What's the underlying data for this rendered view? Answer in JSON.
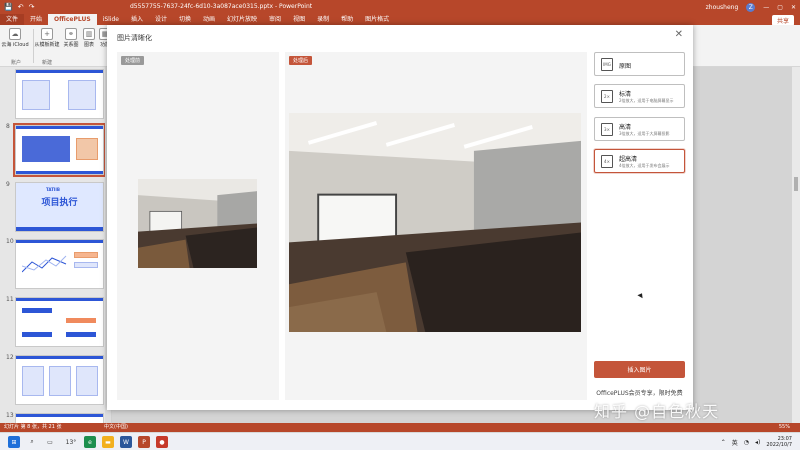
{
  "titlebar": {
    "doc_title": "d5557755-7637-24fc-6d10-3a087ace0315.pptx - PowerPoint",
    "user": "zhousheng",
    "avatar_letter": "Z",
    "min": "—",
    "max": "▢",
    "close": "✕",
    "save_icon": "💾",
    "undo": "↶",
    "redo": "↷"
  },
  "tabs": {
    "items": [
      "文件",
      "开始",
      "OfficePLUS",
      "iSlide",
      "插入",
      "设计",
      "切换",
      "动画",
      "幻灯片放映",
      "审阅",
      "视图",
      "录制",
      "帮助",
      "图片格式"
    ],
    "share_label": "共享"
  },
  "ribbon": {
    "items": [
      {
        "label": "云海 iCloud",
        "icon": "☁"
      },
      {
        "label": "从模板新建",
        "icon": "+"
      },
      {
        "label": "关系图",
        "icon": "⚭"
      },
      {
        "label": "图表",
        "icon": "▥"
      },
      {
        "label": "功能",
        "icon": "▦"
      }
    ],
    "groups": [
      "账户",
      "新建"
    ]
  },
  "slides": {
    "numbers": [
      "8",
      "9",
      "10",
      "11",
      "12",
      "13"
    ],
    "slide9_title": "项目执行",
    "slide9_tag": "TATIIB"
  },
  "dialog": {
    "title": "图片清晰化",
    "close_icon": "✕",
    "before_badge": "处理前",
    "after_badge": "处理后",
    "options": [
      {
        "title": "原图",
        "desc": "",
        "icon": "IMG"
      },
      {
        "title": "标清",
        "desc": "2倍放大，适用于电脑屏幕显示",
        "icon": "2×"
      },
      {
        "title": "高清",
        "desc": "3倍放大，适用于大屏幕投影",
        "icon": "3×"
      },
      {
        "title": "超高清",
        "desc": "4倍放大，适用于发布会展示",
        "icon": "4×"
      }
    ],
    "selected_option": 3,
    "insert_label": "插入图片",
    "vip_note": "OfficePLUS会员专享，限时免费"
  },
  "status": {
    "slide_info": "幻灯片 第 8 张，共 21 张",
    "language": "中文(中国)",
    "zoom": "55%"
  },
  "taskbar": {
    "weather_temp": "13°",
    "lang": "英",
    "time": "23:07",
    "date": "2022/10/7"
  },
  "watermark": "知乎 @自色秋天",
  "colors": {
    "accent": "#b7472a",
    "button": "#c4553a",
    "slide_blue": "#2d56d6",
    "before_badge": "#999999",
    "after_badge": "#c4553a"
  }
}
